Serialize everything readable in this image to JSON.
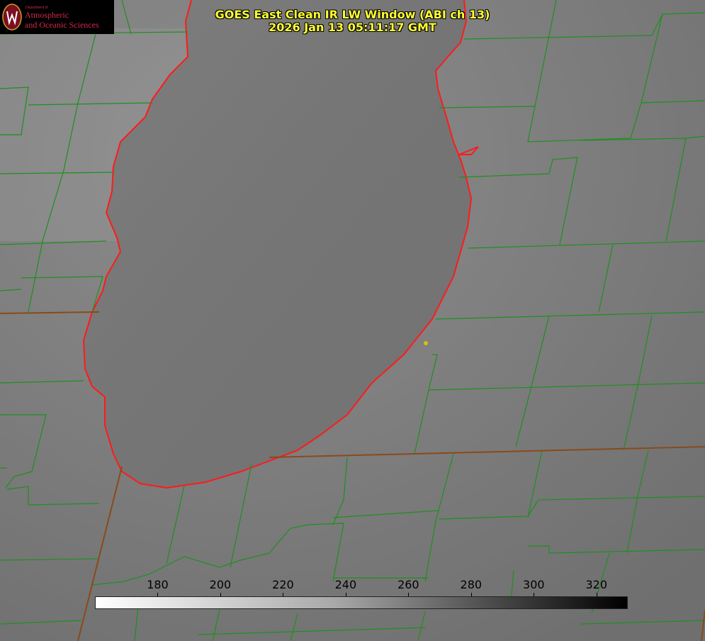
{
  "title": {
    "line1": "GOES East Clean IR LW Window (ABI ch 13)",
    "line2": "2026 Jan 13 05:11:17 GMT"
  },
  "logo": {
    "dept": "Department of",
    "line1": "Atmospheric",
    "line2": "and Oceanic Sciences"
  },
  "colors": {
    "county_lines": "#1f8f1f",
    "state_lines": "#8a4a1a",
    "lake_outline": "#ff1a1a",
    "title_text": "#ffff33",
    "logo_text": "#d6284a",
    "marker": "#d4c200"
  },
  "colorbar": {
    "min": 160,
    "max": 330,
    "ticks": [
      180,
      200,
      220,
      240,
      260,
      280,
      300,
      320
    ],
    "tick_labels": [
      "180",
      "200",
      "220",
      "240",
      "260",
      "280",
      "300",
      "320"
    ]
  }
}
